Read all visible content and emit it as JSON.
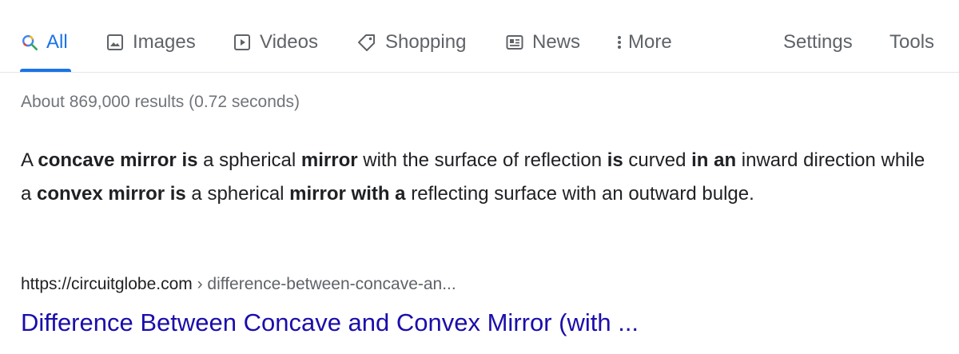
{
  "tabs": {
    "all": {
      "label": "All",
      "icon": "search-icon"
    },
    "images": {
      "label": "Images",
      "icon": "image-icon"
    },
    "videos": {
      "label": "Videos",
      "icon": "video-play-icon"
    },
    "shopping": {
      "label": "Shopping",
      "icon": "tag-icon"
    },
    "news": {
      "label": "News",
      "icon": "newspaper-icon"
    },
    "more": {
      "label": "More",
      "icon": "vertical-dots-icon"
    },
    "settings": {
      "label": "Settings"
    },
    "tools": {
      "label": "Tools"
    }
  },
  "stats": {
    "text": "About 869,000 results (0.72 seconds)"
  },
  "snippet": {
    "parts": [
      {
        "text": "A ",
        "bold": false
      },
      {
        "text": "concave mirror is",
        "bold": true
      },
      {
        "text": " a spherical ",
        "bold": false
      },
      {
        "text": "mirror",
        "bold": true
      },
      {
        "text": " with the surface of reflection ",
        "bold": false
      },
      {
        "text": "is",
        "bold": true
      },
      {
        "text": " curved ",
        "bold": false
      },
      {
        "text": "in an",
        "bold": true
      },
      {
        "text": " inward direction while a ",
        "bold": false
      },
      {
        "text": "convex mirror is",
        "bold": true
      },
      {
        "text": " a spherical ",
        "bold": false
      },
      {
        "text": "mirror with a",
        "bold": true
      },
      {
        "text": " reflecting surface with an outward bulge.",
        "bold": false
      }
    ]
  },
  "result": {
    "domain": "https://circuitglobe.com",
    "breadcrumb": " › difference-between-concave-an...",
    "title": "Difference Between Concave and Convex Mirror (with ..."
  },
  "colors": {
    "accent": "#1a73e8",
    "link": "#1a0dab",
    "muted": "#70757a",
    "text": "#202124"
  }
}
